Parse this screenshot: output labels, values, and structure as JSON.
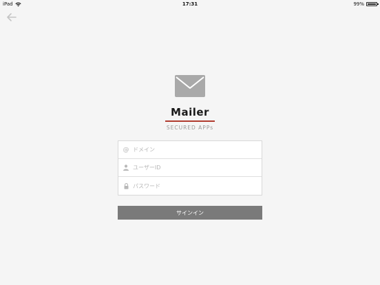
{
  "status_bar": {
    "device": "iPad",
    "time": "17:31",
    "battery": "99%",
    "battery_level": 0.99
  },
  "header": {
    "back_icon": "arrow-left-icon"
  },
  "branding": {
    "logo_icon": "envelope-icon",
    "title": "Mailer",
    "subtitle": "SECURED APPs",
    "accent_color": "#b03a2e"
  },
  "form": {
    "domain": {
      "icon": "at-icon",
      "placeholder": "ドメイン",
      "value": ""
    },
    "user_id": {
      "icon": "user-icon",
      "placeholder": "ユーザーID",
      "value": ""
    },
    "password": {
      "icon": "lock-icon",
      "placeholder": "パスワード",
      "value": ""
    }
  },
  "actions": {
    "signin_label": "サインイン",
    "signin_color": "#7a7a7a"
  }
}
